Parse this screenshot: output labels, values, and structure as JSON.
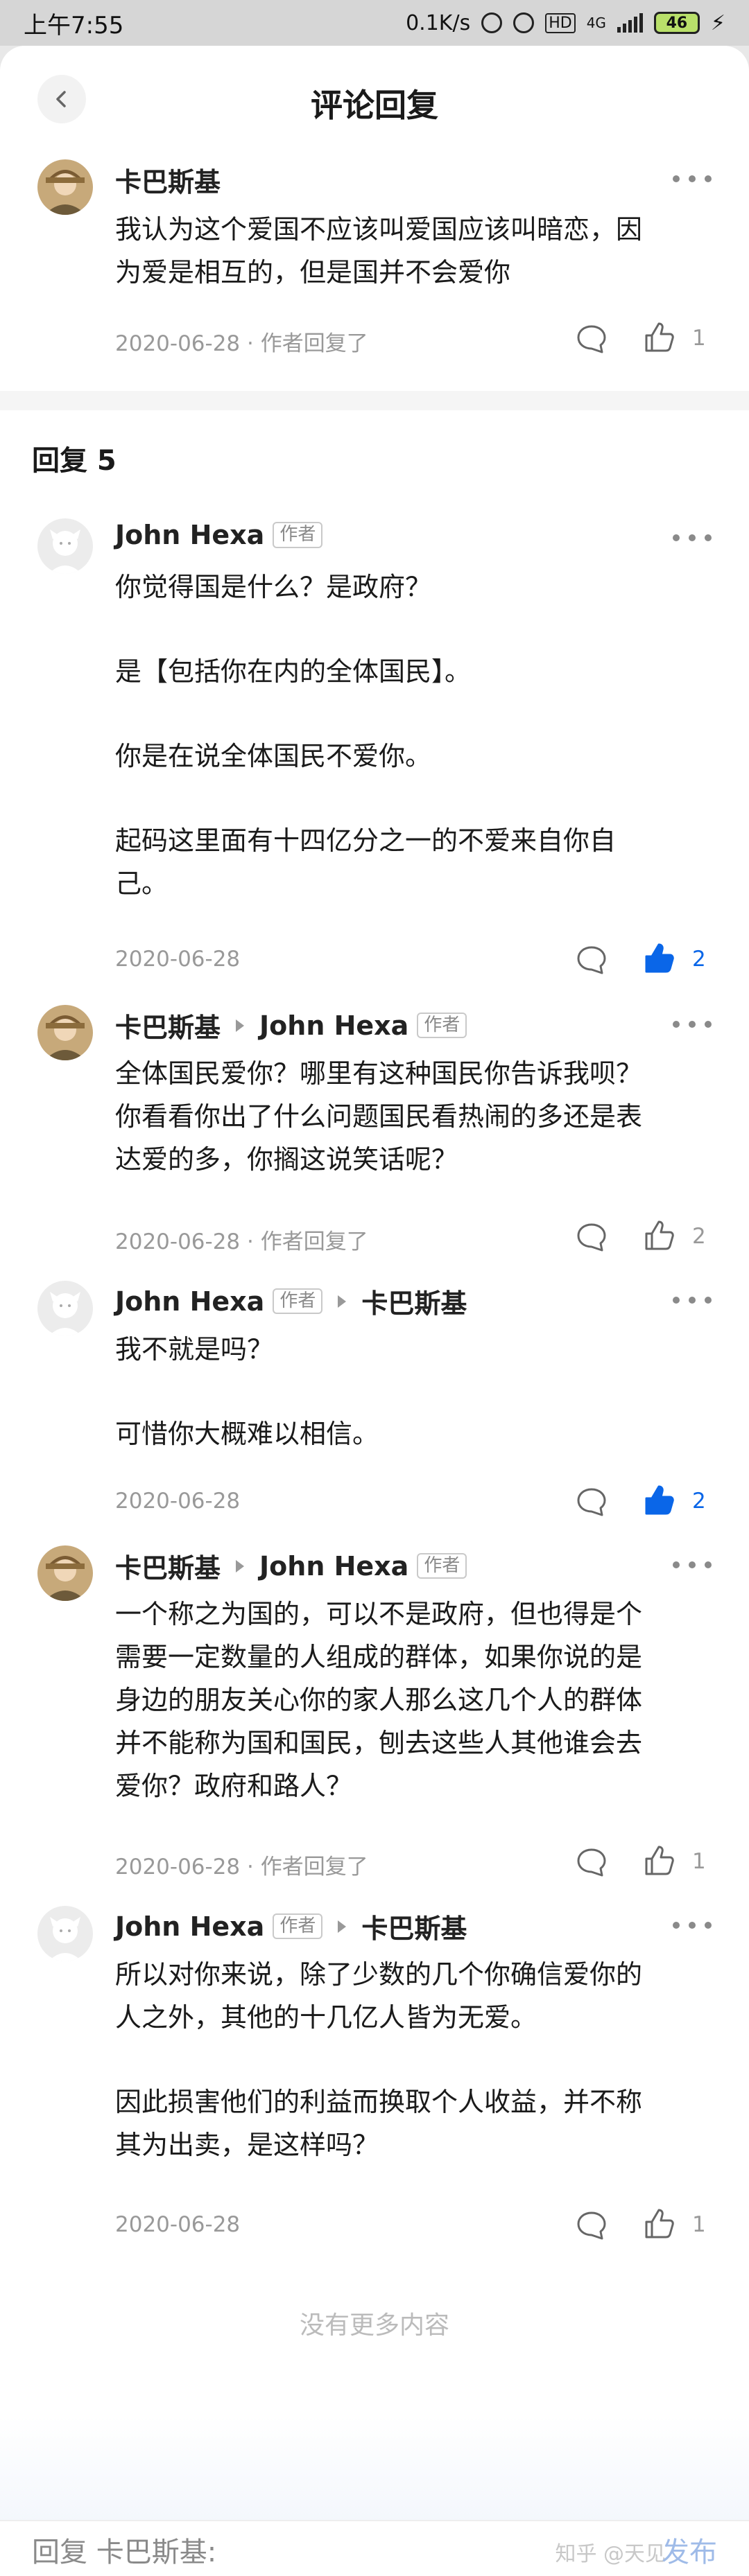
{
  "status": {
    "time": "上午7:55",
    "speed": "0.1K/s",
    "network": "4G",
    "hd": "HD",
    "battery": "46"
  },
  "header": {
    "title": "评论回复",
    "back_icon": "chevron-left-icon"
  },
  "root_comment": {
    "author": "卡巴斯基",
    "lines": [
      "我认为这个爱国不应该叫爱国应该叫暗恋，因",
      "为爱是相互的，但是国并不会爱你"
    ],
    "meta": "2020-06-28 · 作者回复了",
    "likes": "1"
  },
  "replies_section": {
    "title": "回复 5"
  },
  "replies": [
    {
      "author": "John Hexa",
      "author_badge": "作者",
      "lines": [
        "你觉得国是什么？是政府？",
        "",
        "是【包括你在内的全体国民】。",
        "",
        "你是在说全体国民不爱你。",
        "",
        "起码这里面有十四亿分之一的不爱来自你自",
        "己。"
      ],
      "meta": "2020-06-28",
      "likes": "2",
      "liked": true
    },
    {
      "author": "卡巴斯基",
      "reply_to": "John Hexa",
      "reply_to_badge": "作者",
      "lines": [
        "全体国民爱你？哪里有这种国民你告诉我呗？",
        "你看看你出了什么问题国民看热闹的多还是表",
        "达爱的多，你搁这说笑话呢？"
      ],
      "meta": "2020-06-28 · 作者回复了",
      "likes": "2",
      "liked": false
    },
    {
      "author": "John Hexa",
      "author_badge": "作者",
      "reply_to": "卡巴斯基",
      "lines": [
        "我不就是吗？",
        "",
        "可惜你大概难以相信。"
      ],
      "meta": "2020-06-28",
      "likes": "2",
      "liked": true
    },
    {
      "author": "卡巴斯基",
      "reply_to": "John Hexa",
      "reply_to_badge": "作者",
      "lines": [
        "一个称之为国的，可以不是政府，但也得是个",
        "需要一定数量的人组成的群体，如果你说的是",
        "身边的朋友关心你的家人那么这几个人的群体",
        "并不能称为国和国民，刨去这些人其他谁会去",
        "爱你？政府和路人？"
      ],
      "meta": "2020-06-28 · 作者回复了",
      "likes": "1",
      "liked": false
    },
    {
      "author": "John Hexa",
      "author_badge": "作者",
      "reply_to": "卡巴斯基",
      "lines": [
        "所以对你来说，除了少数的几个你确信爱你的",
        "人之外，其他的十几亿人皆为无爱。",
        "",
        "因此损害他们的利益而换取个人收益，并不称",
        "其为出卖，是这样吗？"
      ],
      "meta": "2020-06-28",
      "likes": "1",
      "liked": false
    }
  ],
  "footer": {
    "no_more": "没有更多内容",
    "reply_placeholder": "回复 卡巴斯基:",
    "send_label": "发布",
    "watermark": "知乎 @天见"
  },
  "colors": {
    "accent": "#0a66e8",
    "muted": "#999999"
  }
}
